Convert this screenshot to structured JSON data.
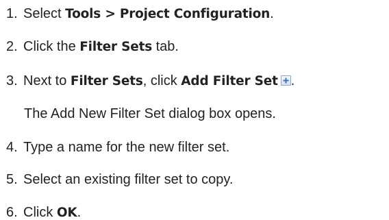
{
  "steps": [
    {
      "num": "1.",
      "pre": "Select ",
      "bold": "Tools > Project Configuration",
      "post": "."
    },
    {
      "num": "2.",
      "pre": "Click the ",
      "bold": "Filter Sets",
      "post": " tab."
    },
    {
      "num": "3.",
      "pre": "Next to ",
      "bold": "Filter Sets",
      "mid": ", click ",
      "bold2": "Add Filter Set",
      "post": "."
    },
    {
      "num": "4.",
      "text": "Type a name for the new filter set."
    },
    {
      "num": "5.",
      "text": "Select an existing filter set to copy."
    },
    {
      "num": "6.",
      "pre": "Click ",
      "bold": "OK",
      "post": "."
    }
  ],
  "note_step3": "The Add New Filter Set dialog box opens.",
  "icons": {
    "add_filter_set": "add-icon"
  }
}
